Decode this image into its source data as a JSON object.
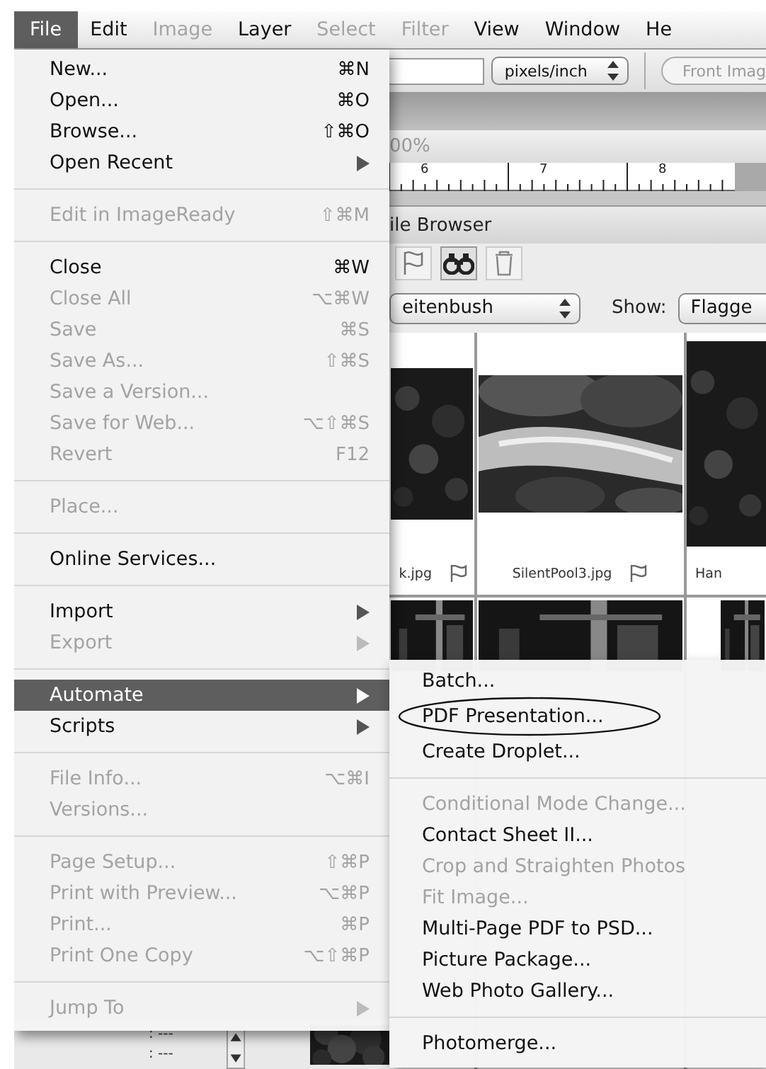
{
  "menubar": [
    {
      "label": "File",
      "selected": true,
      "disabled": false
    },
    {
      "label": "Edit",
      "selected": false,
      "disabled": false
    },
    {
      "label": "Image",
      "selected": false,
      "disabled": true
    },
    {
      "label": "Layer",
      "selected": false,
      "disabled": false
    },
    {
      "label": "Select",
      "selected": false,
      "disabled": true
    },
    {
      "label": "Filter",
      "selected": false,
      "disabled": true
    },
    {
      "label": "View",
      "selected": false,
      "disabled": false
    },
    {
      "label": "Window",
      "selected": false,
      "disabled": false
    },
    {
      "label": "He",
      "selected": false,
      "disabled": false
    }
  ],
  "file_menu": {
    "items": [
      {
        "kind": "item",
        "label": "New...",
        "shortcut": "⌘N",
        "disabled": false,
        "submenu": false,
        "selected": false
      },
      {
        "kind": "item",
        "label": "Open...",
        "shortcut": "⌘O",
        "disabled": false,
        "submenu": false,
        "selected": false
      },
      {
        "kind": "item",
        "label": "Browse...",
        "shortcut": "⇧⌘O",
        "disabled": false,
        "submenu": false,
        "selected": false
      },
      {
        "kind": "item",
        "label": "Open Recent",
        "disabled": false,
        "submenu": true,
        "selected": false
      },
      {
        "kind": "separator"
      },
      {
        "kind": "item",
        "label": "Edit in ImageReady",
        "shortcut": "⇧⌘M",
        "disabled": true,
        "submenu": false,
        "selected": false
      },
      {
        "kind": "separator"
      },
      {
        "kind": "item",
        "label": "Close",
        "shortcut": "⌘W",
        "disabled": false,
        "submenu": false,
        "selected": false
      },
      {
        "kind": "item",
        "label": "Close All",
        "shortcut": "⌥⌘W",
        "disabled": true,
        "submenu": false,
        "selected": false
      },
      {
        "kind": "item",
        "label": "Save",
        "shortcut": "⌘S",
        "disabled": true,
        "submenu": false,
        "selected": false
      },
      {
        "kind": "item",
        "label": "Save As...",
        "shortcut": "⇧⌘S",
        "disabled": true,
        "submenu": false,
        "selected": false
      },
      {
        "kind": "item",
        "label": "Save a Version...",
        "disabled": true,
        "submenu": false,
        "selected": false
      },
      {
        "kind": "item",
        "label": "Save for Web...",
        "shortcut": "⌥⇧⌘S",
        "disabled": true,
        "submenu": false,
        "selected": false
      },
      {
        "kind": "item",
        "label": "Revert",
        "shortcut": "F12",
        "disabled": true,
        "submenu": false,
        "selected": false
      },
      {
        "kind": "separator"
      },
      {
        "kind": "item",
        "label": "Place...",
        "disabled": true,
        "submenu": false,
        "selected": false
      },
      {
        "kind": "separator"
      },
      {
        "kind": "item",
        "label": "Online Services...",
        "disabled": false,
        "submenu": false,
        "selected": false
      },
      {
        "kind": "separator"
      },
      {
        "kind": "item",
        "label": "Import",
        "disabled": false,
        "submenu": true,
        "selected": false
      },
      {
        "kind": "item",
        "label": "Export",
        "disabled": true,
        "submenu": true,
        "selected": false
      },
      {
        "kind": "separator"
      },
      {
        "kind": "item",
        "label": "Automate",
        "disabled": false,
        "submenu": true,
        "selected": true
      },
      {
        "kind": "item",
        "label": "Scripts",
        "disabled": false,
        "submenu": true,
        "selected": false
      },
      {
        "kind": "separator"
      },
      {
        "kind": "item",
        "label": "File Info...",
        "shortcut": "⌥⌘I",
        "disabled": true,
        "submenu": false,
        "selected": false
      },
      {
        "kind": "item",
        "label": "Versions...",
        "disabled": true,
        "submenu": false,
        "selected": false
      },
      {
        "kind": "separator"
      },
      {
        "kind": "item",
        "label": "Page Setup...",
        "shortcut": "⇧⌘P",
        "disabled": true,
        "submenu": false,
        "selected": false
      },
      {
        "kind": "item",
        "label": "Print with Preview...",
        "shortcut": "⌥⌘P",
        "disabled": true,
        "submenu": false,
        "selected": false
      },
      {
        "kind": "item",
        "label": "Print...",
        "shortcut": "⌘P",
        "disabled": true,
        "submenu": false,
        "selected": false
      },
      {
        "kind": "item",
        "label": "Print One Copy",
        "shortcut": "⌥⇧⌘P",
        "disabled": true,
        "submenu": false,
        "selected": false
      },
      {
        "kind": "separator"
      },
      {
        "kind": "item",
        "label": "Jump To",
        "disabled": true,
        "submenu": true,
        "selected": false
      }
    ]
  },
  "automate_menu": {
    "items": [
      {
        "kind": "item",
        "label": "Batch...",
        "disabled": false,
        "circled": false
      },
      {
        "kind": "item",
        "label": "PDF Presentation...",
        "disabled": false,
        "circled": true
      },
      {
        "kind": "item",
        "label": "Create Droplet...",
        "disabled": false,
        "circled": false
      },
      {
        "kind": "separator"
      },
      {
        "kind": "item",
        "label": "Conditional Mode Change...",
        "disabled": true,
        "circled": false
      },
      {
        "kind": "item",
        "label": "Contact Sheet II...",
        "disabled": false,
        "circled": false
      },
      {
        "kind": "item",
        "label": "Crop and Straighten Photos",
        "disabled": true,
        "circled": false
      },
      {
        "kind": "item",
        "label": "Fit Image...",
        "disabled": true,
        "circled": false
      },
      {
        "kind": "item",
        "label": "Multi-Page PDF to PSD...",
        "disabled": false,
        "circled": false
      },
      {
        "kind": "item",
        "label": "Picture Package...",
        "disabled": false,
        "circled": false
      },
      {
        "kind": "item",
        "label": "Web Photo Gallery...",
        "disabled": false,
        "circled": false
      },
      {
        "kind": "separator"
      },
      {
        "kind": "item",
        "label": "Photomerge...",
        "disabled": false,
        "circled": false
      }
    ]
  },
  "options_bar": {
    "unit": "pixels/inch",
    "button": "Front Imag"
  },
  "document": {
    "zoom": "00%",
    "ruler_labels": [
      "6",
      "7",
      "8"
    ]
  },
  "file_browser": {
    "title": "ile Browser",
    "folder": "eitenbush",
    "show_label": "Show:",
    "show_value": "Flagge",
    "thumbnails": [
      {
        "name": "k.jpg",
        "flagged": true
      },
      {
        "name": "SilentPool3.jpg",
        "flagged": true
      },
      {
        "name": "Han",
        "flagged": false
      }
    ]
  },
  "bottom_panel": {
    "rows": [
      ": ---",
      ": ---"
    ]
  }
}
